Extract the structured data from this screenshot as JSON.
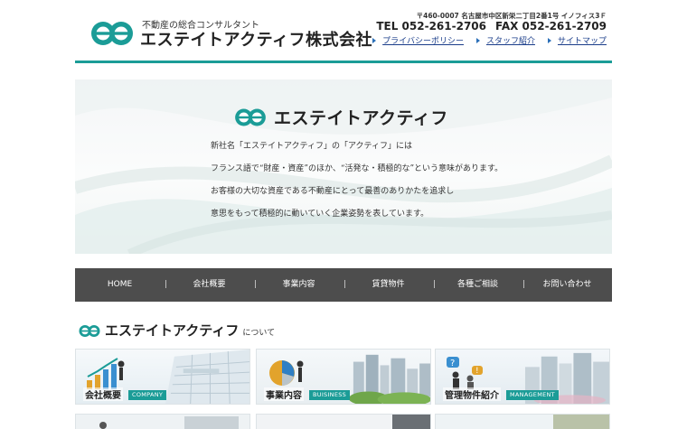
{
  "colors": {
    "accent": "#1b9c97",
    "nav_bg": "#4d4d4d",
    "link": "#1a3d8a"
  },
  "header": {
    "tagline": "不動産の総合コンサルタント",
    "company_name": "エステイトアクティフ株式会社",
    "address": "〒460-0007 名古屋市中区新栄二丁目2番1号 イノフィス3Ｆ",
    "tel": "TEL 052-261-2706",
    "fax": "FAX 052-261-2709",
    "links": [
      "プライバシーポリシー",
      "スタッフ紹介",
      "サイトマップ"
    ]
  },
  "hero": {
    "brand": "エステイトアクティフ",
    "lines": [
      "新社名「エステイトアクティフ」の「アクティフ」には",
      "フランス語で“財産・資産”のほか、“活発な・積極的な”という意味があります。",
      "お客様の大切な資産である不動産にとって最善のありかたを追求し",
      "意思をもって積極的に動いていく企業姿勢を表しています。"
    ]
  },
  "nav": [
    "HOME",
    "会社概要",
    "事業内容",
    "賃貸物件",
    "各種ご相談",
    "お問い合わせ"
  ],
  "about": {
    "brand": "エステイトアクティフ",
    "suffix": "について"
  },
  "cards": [
    {
      "label": "会社概要",
      "tag": "COMPANY",
      "icon": "growth-chart-icon"
    },
    {
      "label": "事業内容",
      "tag": "BUISINESS",
      "icon": "pie-chart-icon"
    },
    {
      "label": "管理物件紹介",
      "tag": "MANAGEMENT",
      "icon": "question-people-icon"
    }
  ]
}
